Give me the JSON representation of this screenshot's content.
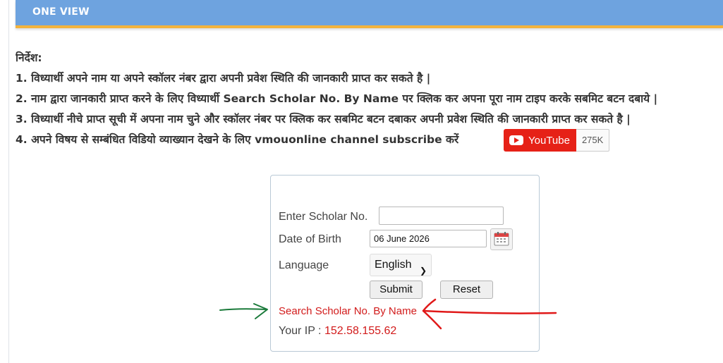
{
  "header": {
    "title": "ONE VIEW"
  },
  "instructions": {
    "heading": "निर्देश:",
    "lines": [
      "1. विध्यार्थी अपने नाम या अपने स्कॉलर नंबर द्वारा अपनी प्रवेश स्थिति की जानकारी प्राप्त कर सकते है |",
      "2. नाम द्वारा जानकारी प्राप्त करने के लिए विध्यार्थी Search Scholar No. By Name पर क्लिक कर अपना पूरा नाम टाइप करके सबमिट बटन दबाये |",
      "3. विध्यार्थी नीचे प्राप्त सूची में अपना नाम चुने और स्कॉलर नंबर पर क्लिक कर सबमिट बटन दबाकर अपनी प्रवेश स्थिति की जानकारी प्राप्त कर सकते है |",
      "4. अपने विषय से सम्बंधित विडियो व्याख्यान देखने के लिए vmouonline channel subscribe करें"
    ]
  },
  "youtube": {
    "label": "YouTube",
    "count": "275K",
    "icon": "youtube-play-icon"
  },
  "form": {
    "scholar_label": "Enter Scholar No.",
    "scholar_value": "",
    "dob_label": "Date of Birth",
    "dob_value": "06 June 2026",
    "language_label": "Language",
    "language_value": "English",
    "submit_label": "Submit",
    "reset_label": "Reset",
    "search_link": "Search Scholar No. By Name",
    "ip_label": "Your IP :",
    "ip_value": "152.58.155.62"
  },
  "colors": {
    "header_bg": "#6ea3df",
    "header_accent": "#f3b33d",
    "link_red": "#d21b1b",
    "youtube_red": "#e62117",
    "arrow_green": "#1a7a3a",
    "arrow_red": "#e01818"
  }
}
